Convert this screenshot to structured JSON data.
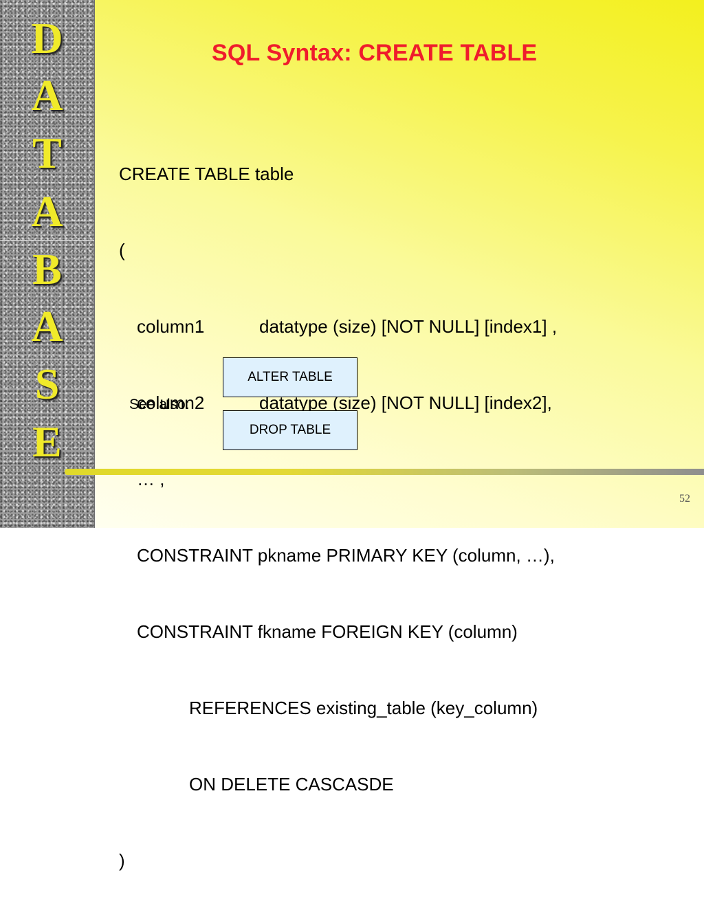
{
  "sidebar": {
    "letters": [
      "D",
      "A",
      "T",
      "A",
      "B",
      "A",
      "S",
      "E"
    ]
  },
  "slide": {
    "title": "SQL Syntax: CREATE TABLE",
    "code_lines": [
      {
        "text": "CREATE TABLE table"
      },
      {
        "text": "("
      },
      {
        "col": "column1",
        "rest": "datatype (size) [NOT NULL] [index1] ,"
      },
      {
        "col": "column2",
        "rest": "datatype (size) [NOT NULL] [index2],"
      },
      {
        "text": "… ,"
      },
      {
        "text": "CONSTRAINT pkname PRIMARY KEY (column, …),"
      },
      {
        "text": "CONSTRAINT fkname FOREIGN KEY (column)"
      },
      {
        "text": "REFERENCES existing_table (key_column)"
      },
      {
        "text": "ON DELETE CASCASDE"
      },
      {
        "text": ")"
      }
    ],
    "see_also_label": "See also:",
    "links": {
      "alter": "ALTER TABLE",
      "drop": "DROP TABLE"
    },
    "page_number": "52"
  },
  "colors": {
    "title": "#ef1c2c",
    "letters": "#f0ea2a",
    "link_box": "#dff1fd"
  }
}
